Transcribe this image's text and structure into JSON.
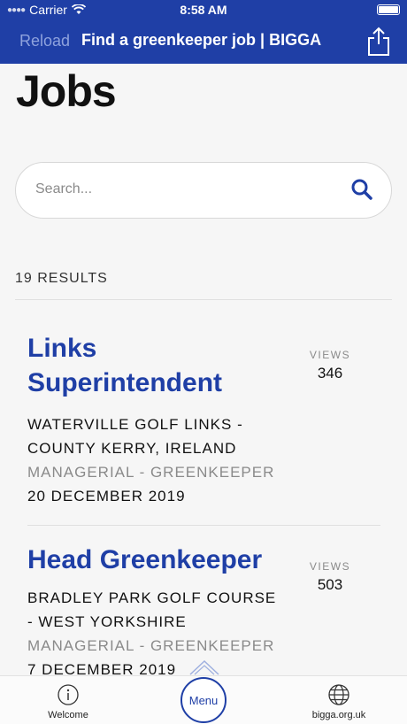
{
  "status": {
    "carrier": "Carrier",
    "time": "8:58 AM"
  },
  "nav": {
    "reload": "Reload",
    "title": "Find a greenkeeper job | BIGGA"
  },
  "page": {
    "heading": "Jobs"
  },
  "search": {
    "placeholder": "Search..."
  },
  "results_label": "19 RESULTS",
  "jobs": [
    {
      "title": "Links Superintendent",
      "location": "WATERVILLE GOLF LINKS - COUNTY KERRY, IRELAND",
      "category": "MANAGERIAL - GREENKEEPER",
      "date": "20 DECEMBER 2019",
      "views_label": "VIEWS",
      "views": "346"
    },
    {
      "title": "Head Greenkeeper",
      "location": "BRADLEY PARK GOLF COURSE - WEST YORKSHIRE",
      "category": "MANAGERIAL - GREENKEEPER",
      "date": "7 DECEMBER 2019",
      "views_label": "VIEWS",
      "views": "503"
    }
  ],
  "tabbar": {
    "welcome": "Welcome",
    "menu": "Menu",
    "site": "bigga.org.uk"
  },
  "colors": {
    "brand": "#1f3fa6",
    "muted": "#8a8a8a",
    "background": "#f6f6f6"
  }
}
